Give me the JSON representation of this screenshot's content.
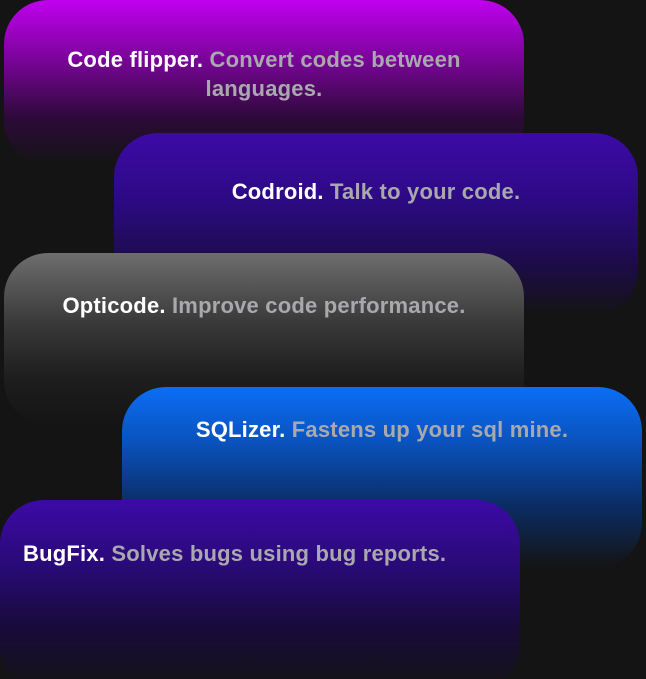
{
  "cards": [
    {
      "name": "Code flipper.",
      "description": "Convert codes between languages."
    },
    {
      "name": "Codroid.",
      "description": "Talk to your code."
    },
    {
      "name": "Opticode.",
      "description": "Improve code performance."
    },
    {
      "name": "SQLizer.",
      "description": "Fastens up your sql mine."
    },
    {
      "name": "BugFix.",
      "description": "Solves bugs using bug reports."
    }
  ],
  "colors": {
    "background": "#141414",
    "title": "#ffffff",
    "description": "#a9a9ad",
    "code_flipper": "#c000f0",
    "codroid": "#3c0aa6",
    "opticode": "#6e6e6e",
    "sqlizer": "#0b6ef5",
    "bugfix": "#3c0aa6"
  }
}
